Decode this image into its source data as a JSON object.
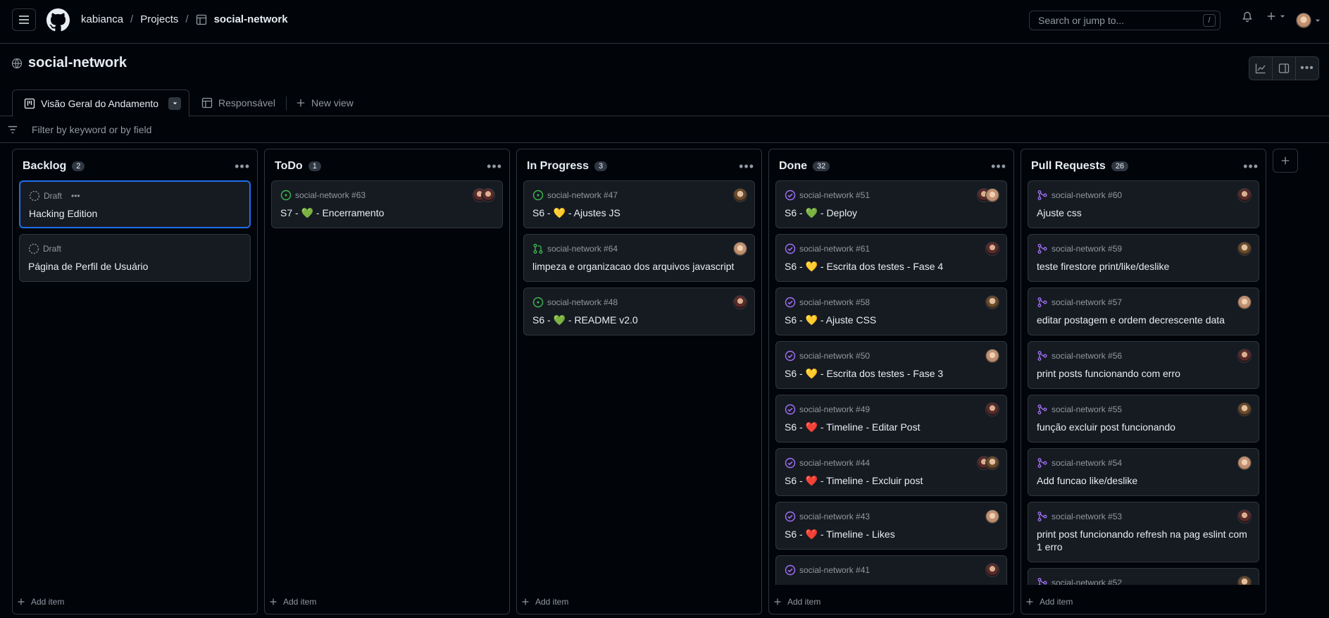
{
  "topbar": {
    "breadcrumbs": [
      "kabianca",
      "Projects",
      "social-network"
    ],
    "search_placeholder": "Search or jump to...",
    "search_shortcut": "/"
  },
  "project": {
    "title": "social-network"
  },
  "tabs": {
    "active_label": "Visão Geral do Andamento",
    "second_label": "Responsável",
    "new_view_label": "New view"
  },
  "filter": {
    "placeholder": "Filter by keyword or by field"
  },
  "columns": [
    {
      "title": "Backlog",
      "count": "2",
      "cards": [
        {
          "meta": "Draft",
          "title": "Hacking Edition",
          "kind": "draft"
        },
        {
          "meta": "Draft",
          "title": "Página de Perfil de Usuário",
          "kind": "draft"
        }
      ]
    },
    {
      "title": "ToDo",
      "count": "1",
      "cards": [
        {
          "meta": "social-network #63",
          "title": "S7 - 💚 - Encerramento",
          "kind": "open"
        }
      ]
    },
    {
      "title": "In Progress",
      "count": "3",
      "cards": [
        {
          "meta": "social-network #47",
          "title": "S6 - 💛 - Ajustes JS",
          "kind": "open"
        },
        {
          "meta": "social-network #64",
          "title": "limpeza e organizacao dos arquivos javascript",
          "kind": "pr-open"
        },
        {
          "meta": "social-network #48",
          "title": "S6 - 💚 - README v2.0",
          "kind": "open"
        }
      ]
    },
    {
      "title": "Done",
      "count": "32",
      "cards": [
        {
          "meta": "social-network #51",
          "title": "S6 - 💚 - Deploy",
          "kind": "closed"
        },
        {
          "meta": "social-network #61",
          "title": "S6 - 💛 - Escrita dos testes - Fase 4",
          "kind": "closed"
        },
        {
          "meta": "social-network #58",
          "title": "S6 - 💛 - Ajuste CSS",
          "kind": "closed"
        },
        {
          "meta": "social-network #50",
          "title": "S6 - 💛 - Escrita dos testes - Fase 3",
          "kind": "closed"
        },
        {
          "meta": "social-network #49",
          "title": "S6 - ❤️ - Timeline - Editar Post",
          "kind": "closed"
        },
        {
          "meta": "social-network #44",
          "title": "S6 - ❤️ - Timeline - Excluir post",
          "kind": "closed"
        },
        {
          "meta": "social-network #43",
          "title": "S6 - ❤️ - Timeline - Likes",
          "kind": "closed"
        },
        {
          "meta": "social-network #41",
          "title": "",
          "kind": "closed"
        }
      ]
    },
    {
      "title": "Pull Requests",
      "count": "26",
      "cards": [
        {
          "meta": "social-network #60",
          "title": "Ajuste css",
          "kind": "merged"
        },
        {
          "meta": "social-network #59",
          "title": "teste firestore print/like/deslike",
          "kind": "merged"
        },
        {
          "meta": "social-network #57",
          "title": "editar postagem e ordem decrescente data",
          "kind": "merged"
        },
        {
          "meta": "social-network #56",
          "title": "print posts funcionando com erro",
          "kind": "merged"
        },
        {
          "meta": "social-network #55",
          "title": "função excluir post funcionando",
          "kind": "merged"
        },
        {
          "meta": "social-network #54",
          "title": "Add funcao like/deslike",
          "kind": "merged"
        },
        {
          "meta": "social-network #53",
          "title": "print post funcionando refresh na pag eslint com 1 erro",
          "kind": "merged"
        },
        {
          "meta": "social-network #52",
          "title": "",
          "kind": "merged"
        }
      ]
    }
  ],
  "add_item_label": "Add item",
  "colors": {
    "open": "#3fb950",
    "closed": "#a371f7",
    "merged": "#a371f7",
    "accent": "#1f6feb"
  }
}
